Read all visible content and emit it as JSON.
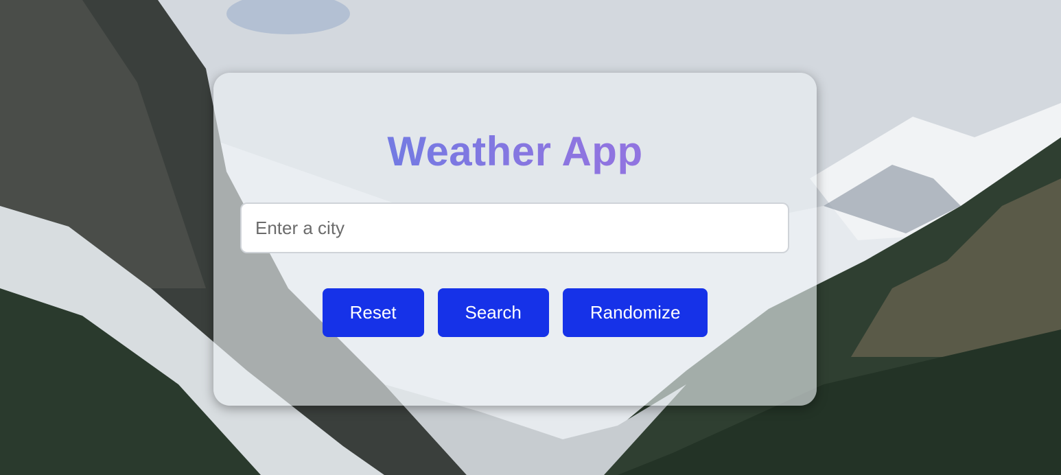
{
  "app": {
    "title": "Weather App"
  },
  "search": {
    "placeholder": "Enter a city",
    "value": ""
  },
  "buttons": {
    "reset_label": "Reset",
    "search_label": "Search",
    "randomize_label": "Randomize"
  },
  "colors": {
    "button_bg": "#1632e8",
    "button_text": "#ffffff",
    "title_gradient_start": "#5b7fe4",
    "title_gradient_end": "#9b6fdf"
  }
}
